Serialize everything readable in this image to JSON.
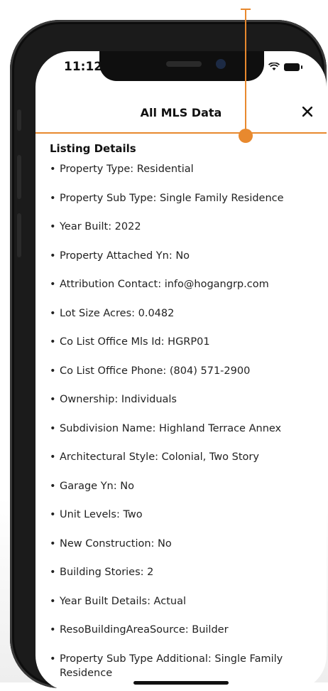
{
  "status": {
    "time": "11:12"
  },
  "header": {
    "title": "All MLS Data",
    "close_icon": "close-icon"
  },
  "section": {
    "title": "Listing Details"
  },
  "details": [
    "Property Type: Residential",
    "Property Sub Type: Single Family Residence",
    "Year Built: 2022",
    "Property Attached Yn: No",
    "Attribution Contact: info@hogangrp.com",
    "Lot Size Acres: 0.0482",
    "Co List Office Mls Id: HGRP01",
    "Co List Office Phone: (804) 571-2900",
    "Ownership: Individuals",
    "Subdivision Name: Highland Terrace Annex",
    "Architectural Style: Colonial, Two Story",
    "Garage Yn: No",
    "Unit Levels: Two",
    "New Construction: No",
    "Building Stories: 2",
    "Year Built Details: Actual",
    "ResoBuildingAreaSource: Builder",
    "Property Sub Type Additional: Single Family Residence"
  ],
  "colors": {
    "accent": "#e8892e",
    "frame": "#1b1b1b"
  }
}
